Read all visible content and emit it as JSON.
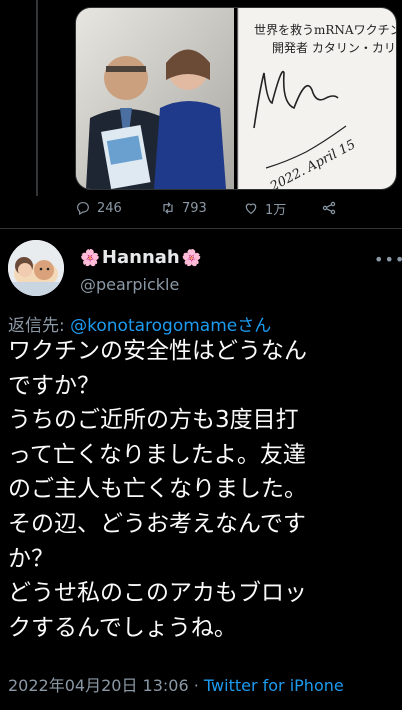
{
  "media": {
    "book_title_line1": "世界を救うmRNAワクチン",
    "book_title_line2": "開発者 カタリン・カリコ",
    "signature_date": "2022. April 15"
  },
  "actions": {
    "replies": "246",
    "retweets": "793",
    "likes": "1万"
  },
  "author": {
    "name": "Hannah",
    "flower_left": "🌸",
    "flower_right": "🌸",
    "handle": "@pearpickle"
  },
  "reply": {
    "prefix": "返信先: ",
    "target": "@konotarogomameさん"
  },
  "tweet": {
    "text": "ワクチンの安全性はどうなん\nですか？\nうちのご近所の方も3度目打\nって亡くなりましたよ。友達\nのご主人も亡くなりました。\nその辺、どうお考えなんです\nか？\nどうせ私のこのアカもブロッ\nクするんでしょうね。"
  },
  "meta": {
    "datetime": "2022年04月20日 13:06",
    "separator": " · ",
    "source": "Twitter for iPhone"
  }
}
